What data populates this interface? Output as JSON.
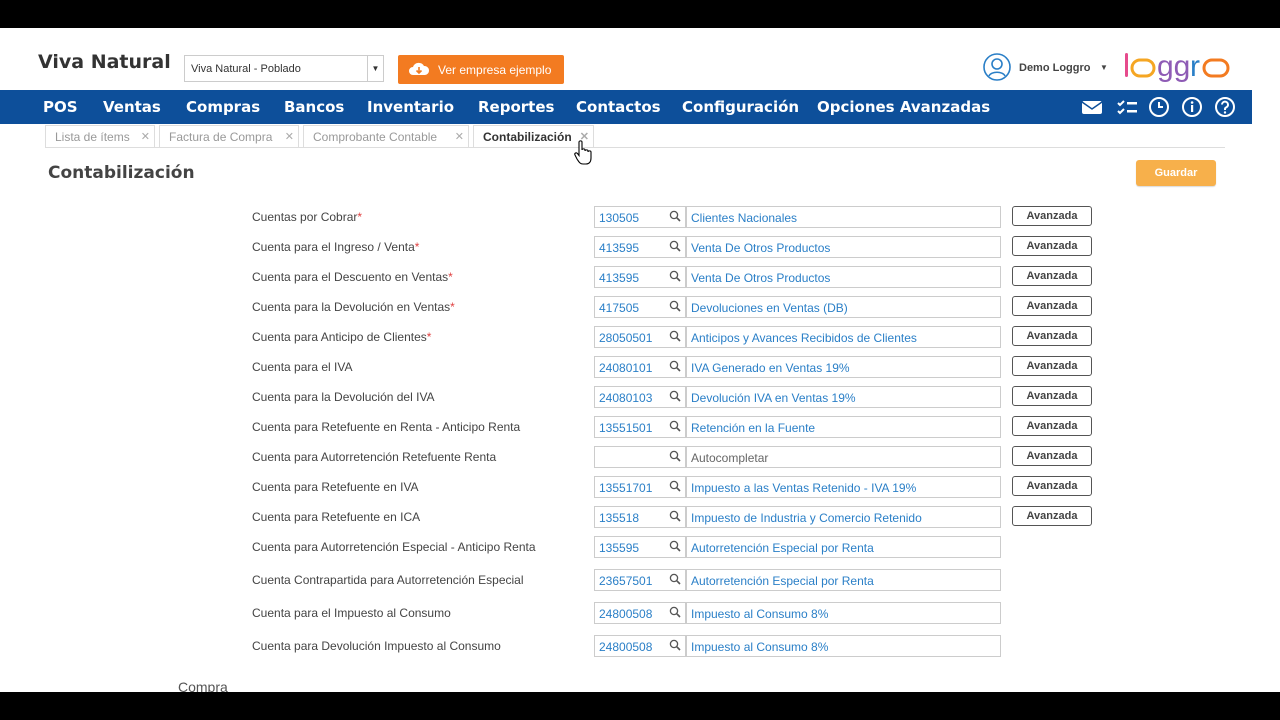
{
  "header": {
    "company": "Viva Natural",
    "branch_select": "Viva Natural - Poblado",
    "example_button": "Ver empresa ejemplo",
    "user_name": "Demo Loggro",
    "logo_text": "loggro"
  },
  "nav": {
    "items": [
      "POS",
      "Ventas",
      "Compras",
      "Bancos",
      "Inventario",
      "Reportes",
      "Contactos",
      "Configuración",
      "Opciones Avanzadas"
    ],
    "icons": [
      "mail-icon",
      "checklist-icon",
      "clock-icon",
      "info-icon",
      "help-icon"
    ]
  },
  "tabs": [
    {
      "label": "Lista de ítems",
      "active": false
    },
    {
      "label": "Factura de Compra",
      "active": false
    },
    {
      "label": "Comprobante Contable",
      "active": false
    },
    {
      "label": "Contabilización",
      "active": true
    }
  ],
  "page": {
    "title": "Contabilización",
    "save_button": "Guardar",
    "advanced_label": "Avanzada",
    "next_section": "Compra"
  },
  "rows": [
    {
      "label": "Cuentas por Cobrar",
      "required": "*",
      "code": "130505",
      "name": "Clientes Nacionales",
      "advanced": true
    },
    {
      "label": "Cuenta para el Ingreso / Venta",
      "required": "*",
      "code": "413595",
      "name": "Venta De Otros Productos",
      "advanced": true
    },
    {
      "label": "Cuenta para el Descuento en Ventas",
      "required": "*",
      "code": "413595",
      "name": "Venta De Otros Productos",
      "advanced": true
    },
    {
      "label": "Cuenta para la Devolución en Ventas",
      "required": "*",
      "code": "417505",
      "name": "Devoluciones en Ventas (DB)",
      "advanced": true
    },
    {
      "label": "Cuenta para Anticipo de Clientes",
      "required": "*",
      "code": "28050501",
      "name": "Anticipos y Avances Recibidos de Clientes",
      "advanced": true
    },
    {
      "label": "Cuenta para el IVA",
      "required": "",
      "code": "24080101",
      "name": "IVA Generado en Ventas 19%",
      "advanced": true
    },
    {
      "label": "Cuenta para la Devolución del IVA",
      "required": "",
      "code": "24080103",
      "name": "Devolución IVA en Ventas 19%",
      "advanced": true
    },
    {
      "label": "Cuenta para Retefuente en Renta - Anticipo Renta",
      "required": "",
      "code": "13551501",
      "name": "Retención en la Fuente",
      "advanced": true
    },
    {
      "label": "Cuenta para Autorretención Retefuente Renta",
      "required": "",
      "code": "",
      "name": "",
      "placeholder": "Autocompletar",
      "advanced": true
    },
    {
      "label": "Cuenta para Retefuente en IVA",
      "required": "",
      "code": "13551701",
      "name": "Impuesto a las Ventas Retenido - IVA 19%",
      "advanced": true
    },
    {
      "label": "Cuenta para Retefuente en ICA",
      "required": "",
      "code": "135518",
      "name": "Impuesto de Industria y Comercio Retenido",
      "advanced": true
    },
    {
      "label": "Cuenta para Autorretención Especial - Anticipo Renta",
      "required": "",
      "code": "135595",
      "name": "Autorretención Especial por Renta",
      "advanced": false
    },
    {
      "label": "Cuenta Contrapartida para Autorretención Especial",
      "required": "",
      "code": "23657501",
      "name": "Autorretención Especial por Renta",
      "advanced": false
    },
    {
      "label": "Cuenta para el Impuesto al Consumo",
      "required": "",
      "code": "24800508",
      "name": "Impuesto al Consumo 8%",
      "advanced": false
    },
    {
      "label": "Cuenta para Devolución Impuesto al Consumo",
      "required": "",
      "code": "24800508",
      "name": "Impuesto al Consumo 8%",
      "advanced": false
    }
  ],
  "colors": {
    "nav_bg": "#0d4f9a",
    "accent_orange": "#f37b21",
    "save_button": "#f7b04b",
    "link_blue": "#2a7fc7"
  }
}
